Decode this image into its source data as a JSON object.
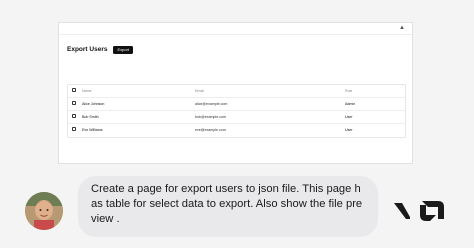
{
  "page": {
    "title": "Export Users",
    "export_button_label": "Export"
  },
  "table": {
    "headers": [
      "Name",
      "Email",
      "Role"
    ],
    "rows": [
      {
        "name": "Alice Johnson",
        "email": "alice@example.com",
        "role": "Admin"
      },
      {
        "name": "Bob Smith",
        "email": "bob@example.com",
        "role": "User"
      },
      {
        "name": "Eve Williams",
        "email": "eve@example.com",
        "role": "User"
      }
    ]
  },
  "chat": {
    "message": "Create a page for export users to json file. This page has table for select data to export. Also show the file preview ."
  },
  "icons": {
    "collapse": "chevron-up-icon",
    "logo": "v0-logo-icon"
  },
  "colors": {
    "button_bg": "#111111",
    "bubble_bg": "#e9e9eb"
  }
}
